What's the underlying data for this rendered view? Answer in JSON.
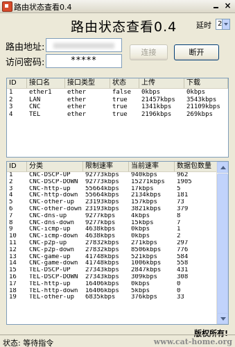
{
  "window": {
    "title": "路由状态查看0.4"
  },
  "heading": "路由状态查看0.4",
  "delay": {
    "label": "延时",
    "value": "2"
  },
  "form": {
    "address_label": "路由地址:",
    "password_label": "访问密码:",
    "password_value": "*****"
  },
  "buttons": {
    "connect": "连接",
    "disconnect": "断开"
  },
  "interfaces": {
    "columns": [
      "ID",
      "接口名",
      "接口类型",
      "状态",
      "上传",
      "下载"
    ],
    "rows": [
      [
        "1",
        "ether1",
        "ether",
        "false",
        "0kbps",
        "0kbps"
      ],
      [
        "2",
        "LAN",
        "ether",
        "true",
        "21457kbps",
        "3543kbps"
      ],
      [
        "3",
        "CNC",
        "ether",
        "true",
        "1341kbps",
        "21109kbps"
      ],
      [
        "4",
        "TEL",
        "ether",
        "true",
        "2196kbps",
        "269kbps"
      ]
    ]
  },
  "queues": {
    "columns": [
      "ID",
      "分类",
      "限制速率",
      "当前速率",
      "数据包数量"
    ],
    "rows": [
      [
        "1",
        "CNC-DSCP-UP",
        "92773kbps",
        "940kbps",
        "962"
      ],
      [
        "2",
        "CNC-DSCP-DOWN",
        "92773kbps",
        "15271kbps",
        "1905"
      ],
      [
        "3",
        "CNC-http-up",
        "55664kbps",
        "17kbps",
        "5"
      ],
      [
        "4",
        "CNC-http-down",
        "55664kbps",
        "2134kbps",
        "181"
      ],
      [
        "5",
        "CNC-other-up",
        "23193kbps",
        "157kbps",
        "73"
      ],
      [
        "6",
        "CNC-other-down",
        "23193kbps",
        "3821kbps",
        "379"
      ],
      [
        "7",
        "CNC-dns-up",
        "9277kbps",
        "4kbps",
        "8"
      ],
      [
        "8",
        "CNC-dns-down",
        "9277kbps",
        "15kbps",
        "7"
      ],
      [
        "9",
        "CNC-icmp-up",
        "4638kbps",
        "0kbps",
        "1"
      ],
      [
        "10",
        "CNC-icmp-down",
        "4638kbps",
        "0kbps",
        "2"
      ],
      [
        "11",
        "CNC-p2p-up",
        "27832kbps",
        "271kbps",
        "297"
      ],
      [
        "12",
        "CNC-p2p-down",
        "27832kbps",
        "8506kbps",
        "776"
      ],
      [
        "13",
        "CNC-game-up",
        "41748kbps",
        "521kbps",
        "584"
      ],
      [
        "14",
        "CNC-game-down",
        "41748kbps",
        "1006kbps",
        "558"
      ],
      [
        "15",
        "TEL-DSCP-UP",
        "27343kbps",
        "2847kbps",
        "431"
      ],
      [
        "16",
        "TEL-DSCP-DOWN",
        "27343kbps",
        "309kbps",
        "308"
      ],
      [
        "17",
        "TEL-http-up",
        "16406kbps",
        "0kbps",
        "0"
      ],
      [
        "18",
        "TEL-http-down",
        "16406kbps",
        "5kbps",
        "0"
      ],
      [
        "19",
        "TEL-other-up",
        "6835kbps",
        "376kbps",
        "33"
      ]
    ]
  },
  "copyright": "版权所有!",
  "status": "状态: 等待指令",
  "watermark": "www.cat-home.org"
}
